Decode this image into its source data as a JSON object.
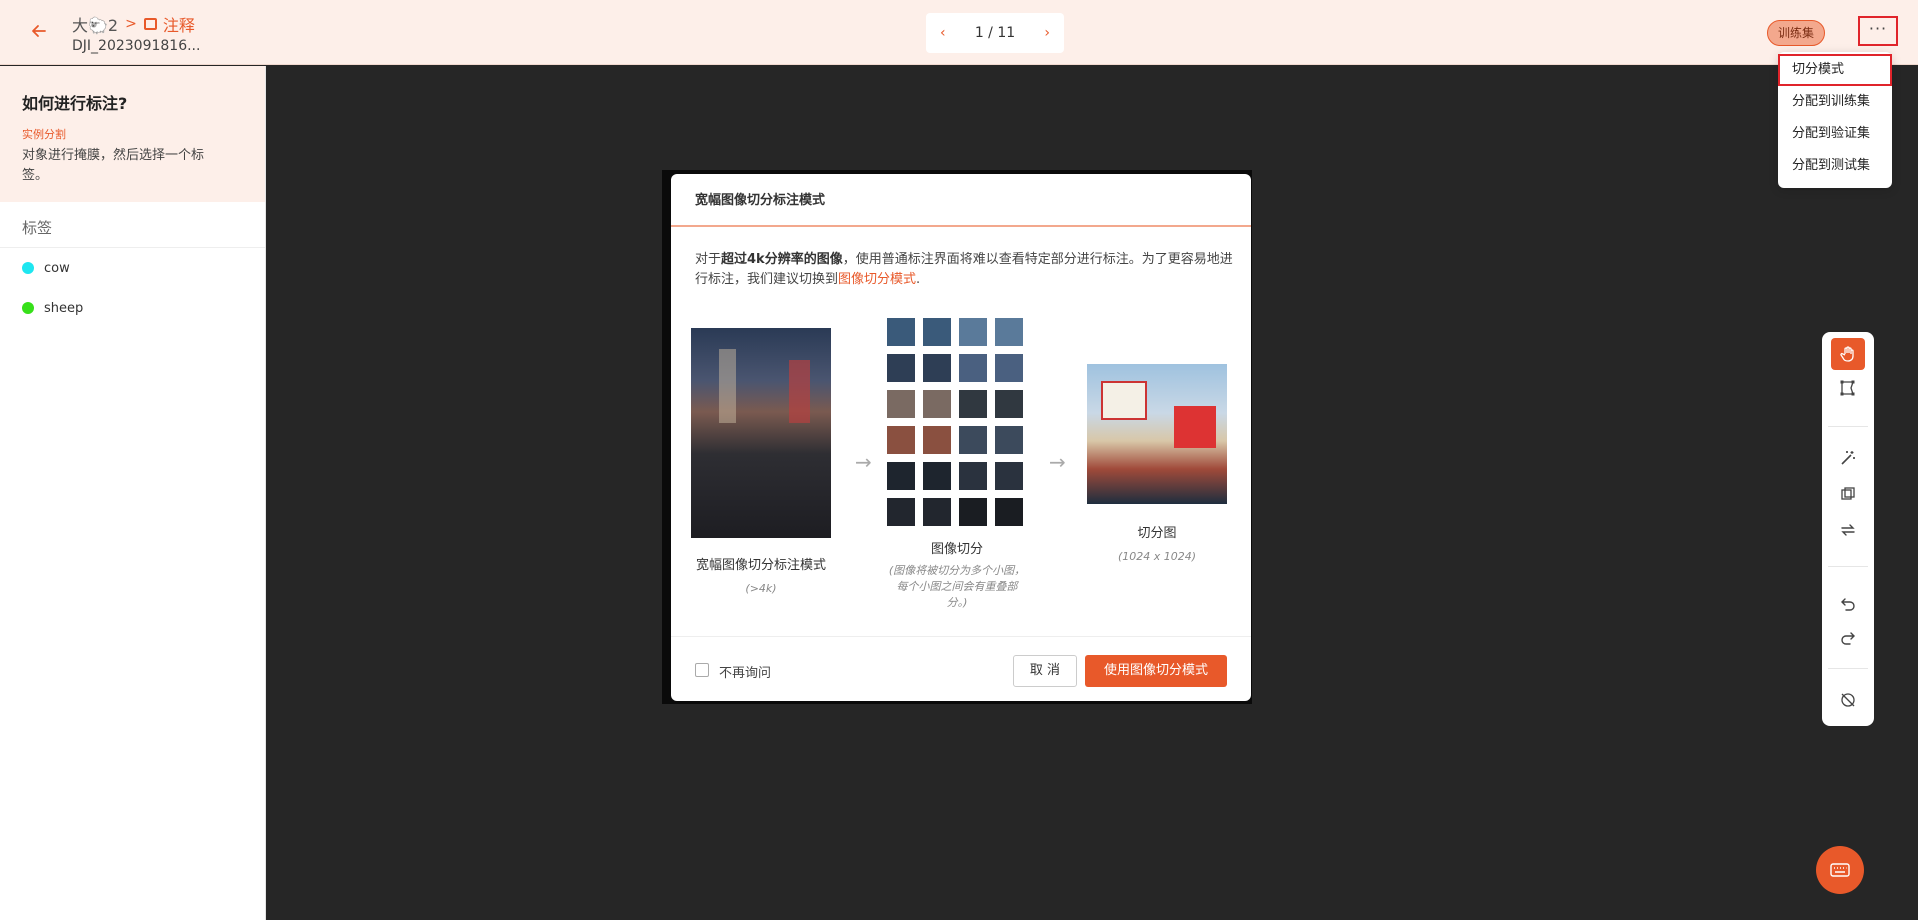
{
  "header": {
    "back_icon": "arrow-left-icon",
    "breadcrumb_project": "大🐑2",
    "breadcrumb_sep": ">",
    "breadcrumb_current": "注释",
    "filename": "DJI_2023091816...",
    "pager": {
      "prev": "‹",
      "text": "1 / 11",
      "next": "›"
    },
    "dataset_tag": "训练集",
    "more_label": "···"
  },
  "menu": {
    "items": [
      "切分模式",
      "分配到训练集",
      "分配到验证集",
      "分配到测试集"
    ]
  },
  "sidebar": {
    "howto_title": "如何进行标注?",
    "howto_type": "实例分割",
    "howto_desc": "对象进行掩膜，然后选择一个标签。",
    "labels_title": "标签",
    "labels": [
      {
        "name": "cow",
        "color": "#1ee6f0"
      },
      {
        "name": "sheep",
        "color": "#37e01a"
      }
    ]
  },
  "dialog": {
    "title": "宽幅图像切分标注模式",
    "intro_1": "对于",
    "intro_bold": "超过4k分辨率的图像",
    "intro_2": "，使用普通标注界面将难以查看特定部分进行标注。为了更容易地进行标注，我们建议切换到",
    "intro_link": "图像切分模式",
    "intro_3": ".",
    "col1_title": "宽幅图像切分标注模式",
    "col1_sub": "(>4k)",
    "col2_title": "图像切分",
    "col2_sub": "(图像将被切分为多个小图，每个小图之间会有重叠部分。)",
    "col3_title": "切分图",
    "col3_sub": "(1024 x 1024)",
    "dont_ask": "不再询问",
    "cancel": "取 消",
    "confirm": "使用图像切分模式"
  },
  "toolbar": {
    "tools": [
      "hand-icon",
      "polygon-icon",
      "magic-wand-icon",
      "crop-icon",
      "swap-icon",
      "undo-icon",
      "redo-icon",
      "hide-icon"
    ]
  },
  "colors": {
    "accent": "#e8592a",
    "header_bg": "#fdefe9",
    "canvas_bg": "#262626"
  }
}
